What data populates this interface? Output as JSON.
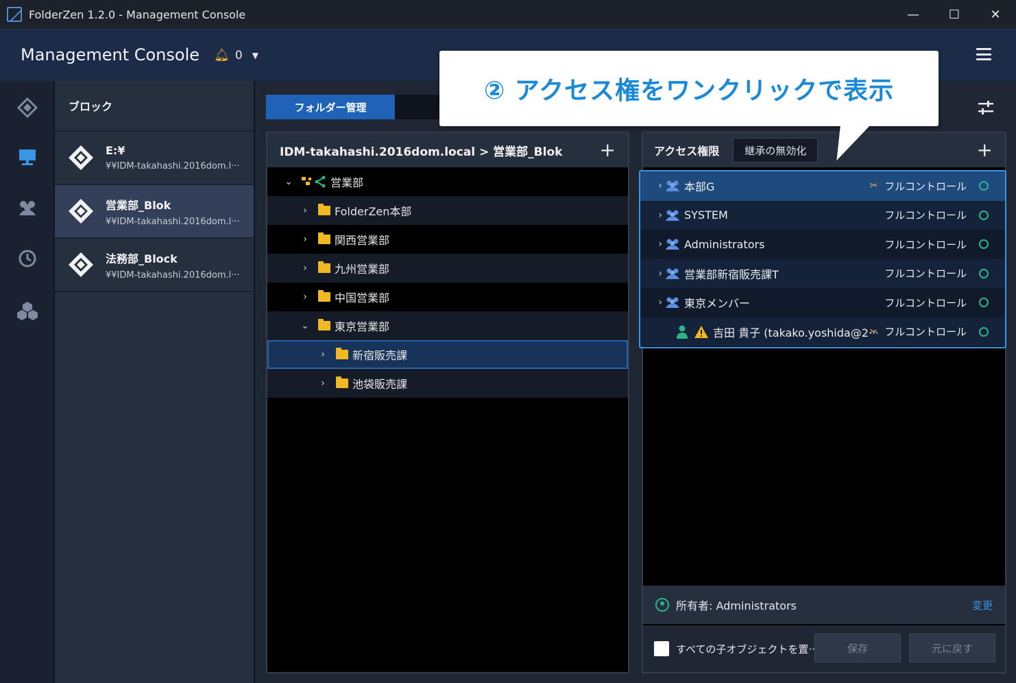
{
  "window": {
    "title": "FolderZen 1.2.0 - Management Console",
    "minimize": "—",
    "maximize": "☐",
    "close": "✕"
  },
  "header": {
    "title": "Management Console",
    "notification_count": "0"
  },
  "rail": {
    "items": [
      "blocks-icon",
      "folder-tree-icon",
      "users-icon",
      "history-icon",
      "groups-icon"
    ]
  },
  "blocks": {
    "header": "ブロック",
    "items": [
      {
        "name": "E:¥",
        "path": "¥¥IDM-takahashi.2016dom.l···"
      },
      {
        "name": "営業部_Blok",
        "path": "¥¥IDM-takahashi.2016dom.l···"
      },
      {
        "name": "法務部_Block",
        "path": "¥¥IDM-takahashi.2016dom.l···"
      }
    ]
  },
  "tabs": {
    "active": "フォルダー管理"
  },
  "tree": {
    "header": "IDM-takahashi.2016dom.local > 営業部_Blok",
    "add": "+",
    "root": "営業部",
    "items": [
      {
        "label": "FolderZen本部"
      },
      {
        "label": "関西営業部"
      },
      {
        "label": "九州営業部"
      },
      {
        "label": "中国営業部"
      },
      {
        "label": "東京営業部"
      },
      {
        "label": "新宿販売課"
      },
      {
        "label": "池袋販売課"
      }
    ]
  },
  "access": {
    "header": "アクセス権限",
    "inherit_button": "継承の無効化",
    "add": "+",
    "entries": [
      {
        "name": "本部G",
        "permission": "フルコントロール"
      },
      {
        "name": "SYSTEM",
        "permission": "フルコントロール"
      },
      {
        "name": "Administrators",
        "permission": "フルコントロール"
      },
      {
        "name": "営業部新宿販売課T",
        "permission": "フルコントロール"
      },
      {
        "name": "東京メンバー",
        "permission": "フルコントロール"
      },
      {
        "name": "吉田 貴子 (takako.yoshida@2···",
        "permission": "フルコントロール"
      }
    ],
    "owner": "所有者: Administrators",
    "change": "変更",
    "replace_children": "すべての子オブジェクトを置···",
    "save": "保存",
    "revert": "元に戻す"
  },
  "callout": {
    "text": "② アクセス権をワンクリックで表示"
  },
  "colors": {
    "accent": "#1e63b8",
    "callout_text": "#1a8ad8",
    "highlight_border": "#3a95e4",
    "status_ok": "#2fb48a",
    "folder": "#f2b823"
  }
}
